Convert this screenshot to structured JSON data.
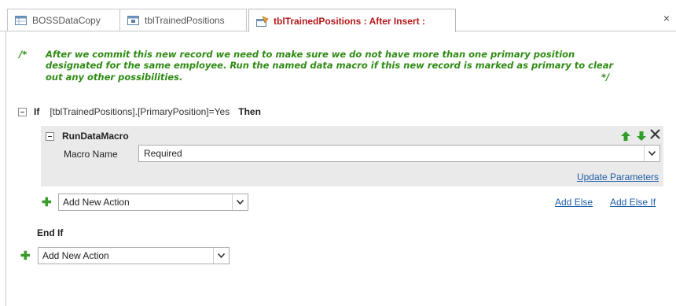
{
  "tabs": [
    {
      "label": "BOSSDataCopy",
      "icon": "table-icon"
    },
    {
      "label": "tblTrainedPositions",
      "icon": "table-icon"
    },
    {
      "label": "tblTrainedPositions : After Insert :",
      "icon": "data-macro-icon",
      "active": true
    }
  ],
  "close_glyph": "×",
  "comment": {
    "open": "/*",
    "text": "After we commit this new record we need to make sure we do not have more than one primary position designated for the same employee. Run the named data macro if this new record is marked as primary to clear out any other possibilities.",
    "close": "*/"
  },
  "if_block": {
    "keyword": "If",
    "condition": "[tblTrainedPositions].[PrimaryPosition]=Yes",
    "then": "Then"
  },
  "action": {
    "name": "RunDataMacro",
    "macro_name_label": "Macro Name",
    "macro_name_value": "Required",
    "update_parameters": "Update Parameters"
  },
  "inner_add_action": "Add New Action",
  "add_else": "Add Else",
  "add_else_if": "Add Else If",
  "end_if": "End If",
  "outer_add_action": "Add New Action",
  "colors": {
    "comment": "#2e8b13",
    "active_tab_text": "#b3171a",
    "link": "#1f5da6",
    "plus": "#3a9a2c",
    "action_bg": "#eaeaea"
  }
}
